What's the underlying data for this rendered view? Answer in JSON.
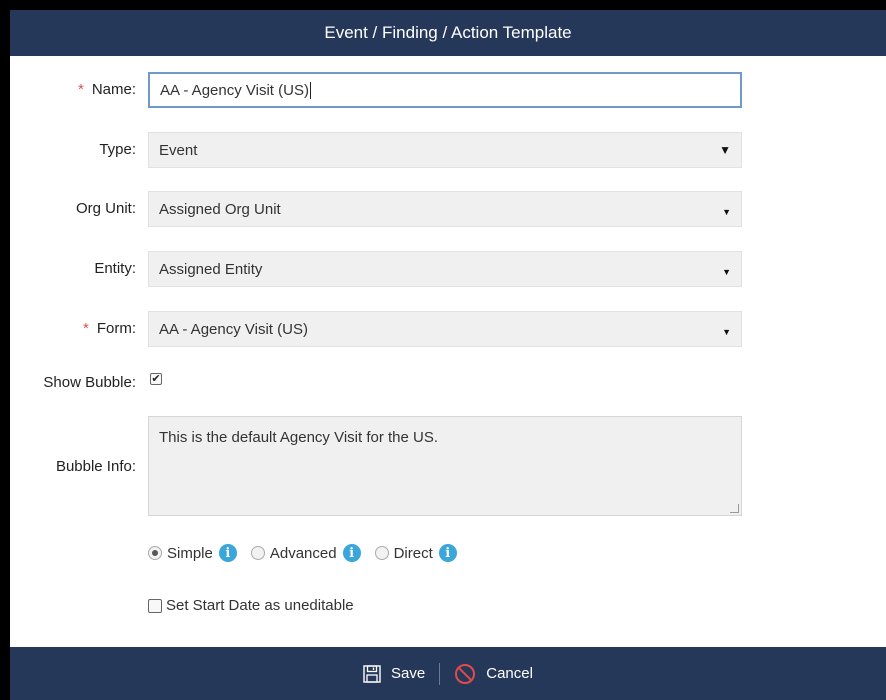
{
  "dialog": {
    "title": "Event / Finding / Action Template"
  },
  "form": {
    "required_mark": "*",
    "name": {
      "label": "Name:",
      "value": "AA - Agency Visit (US)"
    },
    "type": {
      "label": "Type:",
      "value": "Event"
    },
    "org_unit": {
      "label": "Org Unit:",
      "value": "Assigned Org Unit"
    },
    "entity": {
      "label": "Entity:",
      "value": "Assigned Entity"
    },
    "form_field": {
      "label": "Form:",
      "value": "AA - Agency Visit (US)"
    },
    "show_bubble": {
      "label": "Show Bubble:",
      "checked": true
    },
    "bubble_info": {
      "label": "Bubble Info:",
      "value": "This is the default Agency Visit for the US."
    },
    "mode_options": [
      {
        "label": "Simple",
        "selected": true
      },
      {
        "label": "Advanced",
        "selected": false
      },
      {
        "label": "Direct",
        "selected": false
      }
    ],
    "start_date_option": {
      "label": "Set Start Date as uneditable",
      "checked": false
    }
  },
  "footer": {
    "save_label": "Save",
    "cancel_label": "Cancel"
  },
  "colors": {
    "header_bg": "#263859",
    "required": "#d9534f",
    "info_icon": "#3aa6d9",
    "cancel_icon": "#e04b4b",
    "input_focus_border": "#6f99c8"
  }
}
